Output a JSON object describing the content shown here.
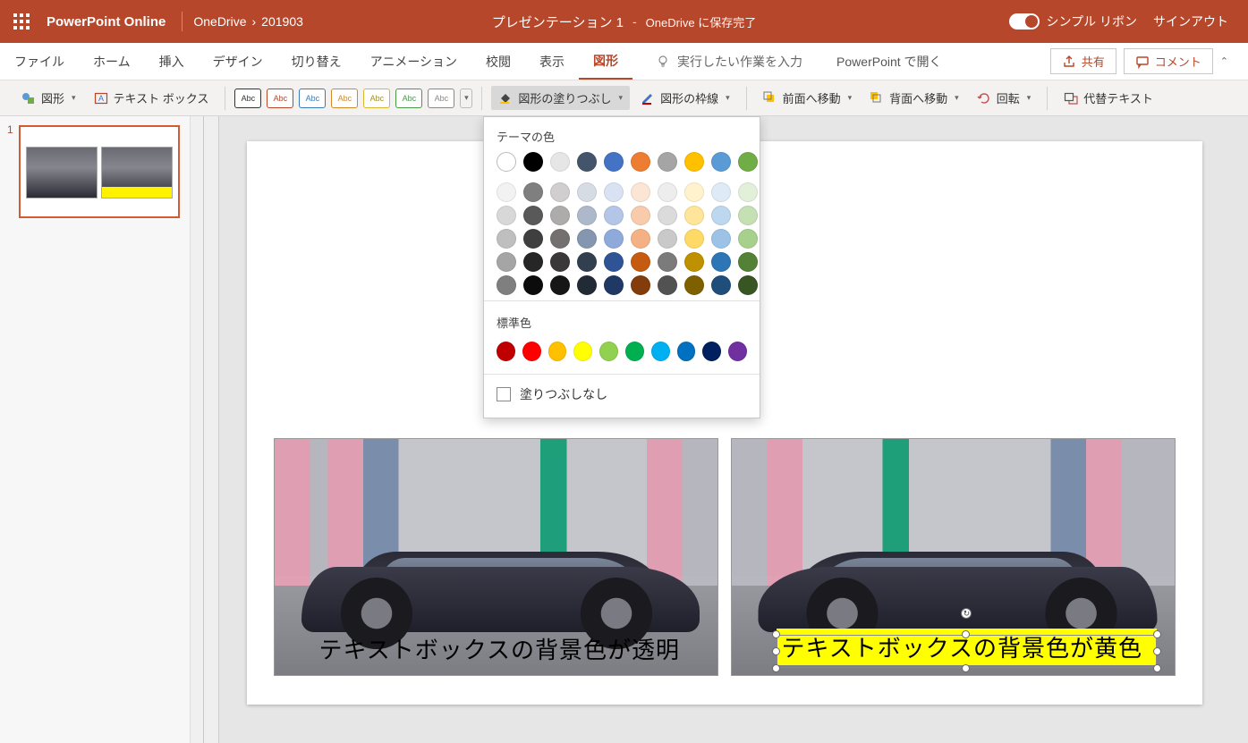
{
  "title_bar": {
    "app_name": "PowerPoint Online",
    "breadcrumb_root": "OneDrive",
    "breadcrumb_folder": "201903",
    "doc_title": "プレゼンテーション 1",
    "separator": "-",
    "save_status": "OneDrive に保存完了",
    "simple_ribbon": "シンプル リボン",
    "sign_out": "サインアウト"
  },
  "tabs": {
    "file": "ファイル",
    "home": "ホーム",
    "insert": "挿入",
    "design": "デザイン",
    "transitions": "切り替え",
    "animations": "アニメーション",
    "review": "校閲",
    "view": "表示",
    "shape_format": "図形",
    "tell_me_placeholder": "実行したい作業を入力",
    "open_desktop": "PowerPoint で開く",
    "share": "共有",
    "comments": "コメント"
  },
  "ribbon": {
    "shapes": "図形",
    "text_box": "テキスト ボックス",
    "style_abc": "Abc",
    "shape_fill": "図形の塗りつぶし",
    "shape_outline": "図形の枠線",
    "bring_forward": "前面へ移動",
    "send_backward": "背面へ移動",
    "rotate": "回転",
    "alt_text": "代替テキスト"
  },
  "picker": {
    "theme_colors_title": "テーマの色",
    "standard_colors_title": "標準色",
    "no_fill": "塗りつぶしなし",
    "theme_row0": [
      "#ffffff",
      "#000000",
      "#e7e6e6",
      "#44546a",
      "#4472c4",
      "#ed7d31",
      "#a5a5a5",
      "#ffc000",
      "#5b9bd5",
      "#70ad47"
    ],
    "theme_shades": [
      [
        "#f2f2f2",
        "#7f7f7f",
        "#d0cece",
        "#d6dce4",
        "#d9e2f3",
        "#fbe5d5",
        "#ededed",
        "#fff2cc",
        "#deebf6",
        "#e2efd9"
      ],
      [
        "#d8d8d8",
        "#595959",
        "#aeabab",
        "#adb9ca",
        "#b4c6e7",
        "#f7cbac",
        "#dbdbdb",
        "#fee599",
        "#bdd7ee",
        "#c5e0b3"
      ],
      [
        "#bfbfbf",
        "#3f3f3f",
        "#757070",
        "#8496b0",
        "#8eaadb",
        "#f4b183",
        "#c9c9c9",
        "#ffd965",
        "#9cc3e5",
        "#a8d08d"
      ],
      [
        "#a5a5a5",
        "#262626",
        "#3a3838",
        "#323f4f",
        "#2f5496",
        "#c55a11",
        "#7b7b7b",
        "#bf9000",
        "#2e75b5",
        "#538135"
      ],
      [
        "#7f7f7f",
        "#0c0c0c",
        "#171616",
        "#222a35",
        "#1f3864",
        "#833c0b",
        "#525252",
        "#7f6000",
        "#1e4e79",
        "#375623"
      ]
    ],
    "standard": [
      "#c00000",
      "#ff0000",
      "#ffc000",
      "#ffff00",
      "#92d050",
      "#00b050",
      "#00b0f0",
      "#0070c0",
      "#002060",
      "#7030a0"
    ]
  },
  "panel": {
    "slide_number": "1"
  },
  "slide": {
    "caption_left": "テキストボックスの背景色が透明",
    "caption_right": "テキストボックスの背景色が黄色"
  }
}
